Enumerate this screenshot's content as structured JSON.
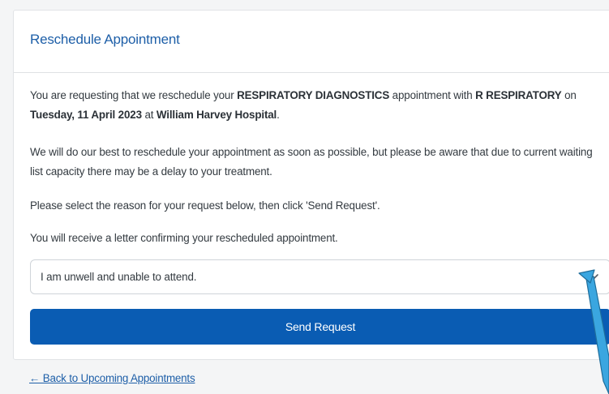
{
  "header": {
    "title": "Reschedule Appointment"
  },
  "intro": {
    "t1": "You are requesting that we reschedule your ",
    "department": "RESPIRATORY DIAGNOSTICS",
    "t2": " appointment with ",
    "clinician": "R RESPIRATORY",
    "t3": " on ",
    "date": "Tuesday, 11 April 2023",
    "t4": " at ",
    "location": "William Harvey Hospital",
    "t5": "."
  },
  "notice": "We will do our best to reschedule your appointment as soon as possible, but please be aware that due to current waiting list capacity there may be a delay to your treatment.",
  "instruction": "Please select the reason for your request below, then click 'Send Request'.",
  "confirmation": "You will receive a letter confirming your rescheduled appointment.",
  "reason_select": {
    "selected": "I am unwell and unable to attend."
  },
  "send_button": {
    "label": "Send Request"
  },
  "back_link": {
    "label": "← Back to Upcoming Appointments"
  },
  "colors": {
    "accent": "#0a5cb3",
    "title": "#1e5fa8",
    "annotation": "#3aa6e0"
  }
}
